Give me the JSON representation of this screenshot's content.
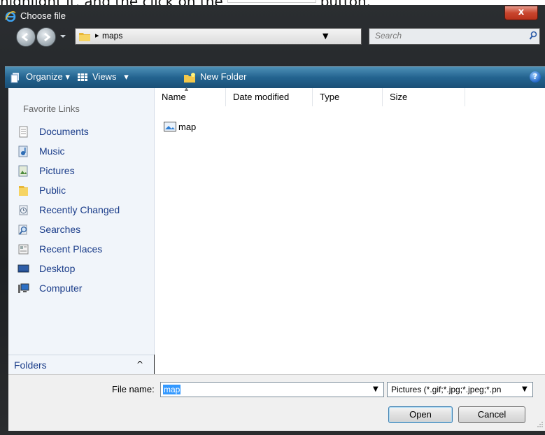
{
  "page_text": {
    "before": "highlight it, and the click on the",
    "after": "button."
  },
  "window": {
    "title": "Choose file",
    "close_label": "x"
  },
  "nav": {
    "path": "maps",
    "search_placeholder": "Search"
  },
  "toolbar": {
    "organize": "Organize",
    "views": "Views",
    "new_folder": "New Folder",
    "help": "?"
  },
  "sidebar": {
    "title": "Favorite Links",
    "items": [
      {
        "label": "Documents",
        "icon": "documents-icon"
      },
      {
        "label": "Music",
        "icon": "music-icon"
      },
      {
        "label": "Pictures",
        "icon": "pictures-icon"
      },
      {
        "label": "Public",
        "icon": "public-folder-icon"
      },
      {
        "label": "Recently Changed",
        "icon": "recently-changed-icon"
      },
      {
        "label": "Searches",
        "icon": "searches-icon"
      },
      {
        "label": "Recent Places",
        "icon": "recent-places-icon"
      },
      {
        "label": "Desktop",
        "icon": "desktop-icon"
      },
      {
        "label": "Computer",
        "icon": "computer-icon"
      }
    ],
    "folders_label": "Folders"
  },
  "columns": [
    "Name",
    "Date modified",
    "Type",
    "Size"
  ],
  "files": [
    {
      "name": "map",
      "icon": "image-file-icon"
    }
  ],
  "bottom": {
    "file_name_label": "File name:",
    "file_name_value": "map",
    "file_type": "Pictures (*.gif;*.jpg;*.jpeg;*.pn",
    "open_label": "Open",
    "cancel_label": "Cancel"
  },
  "colors": {
    "toolbar": "#23638f",
    "link_text": "#1b3d8a",
    "selection": "#3399ff",
    "close_button": "#c9452d"
  }
}
